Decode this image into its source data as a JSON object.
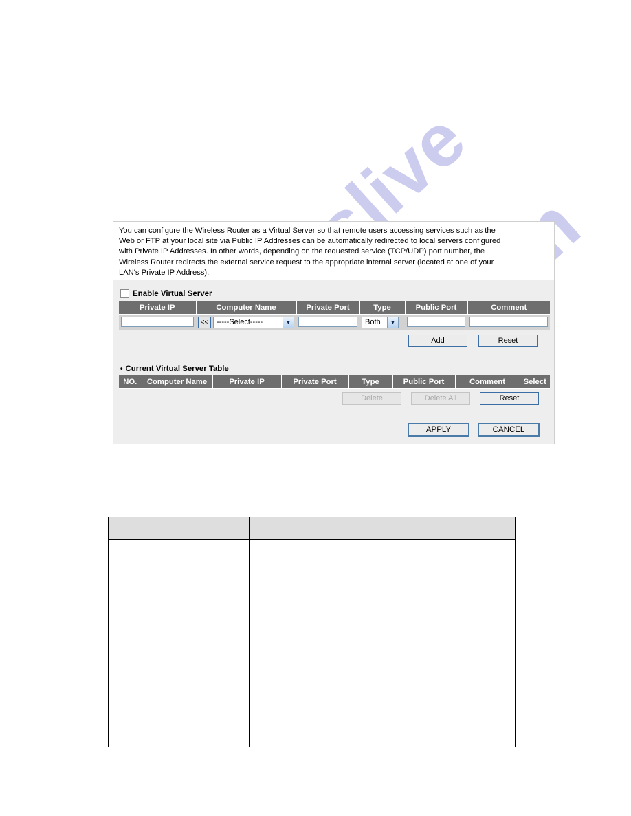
{
  "watermark": {
    "part1": "manualslive",
    "part2": ".com"
  },
  "panel": {
    "intro_lines": [
      "You can configure the Wireless Router as a Virtual Server so that remote users accessing services such as the",
      "Web or FTP at your local site via Public IP Addresses can be automatically redirected to local servers configured",
      "with Private IP Addresses. In other words, depending on the requested service (TCP/UDP) port number, the",
      "Wireless Router redirects the external service request to the appropriate internal server (located at one of your",
      "LAN's Private IP Address)."
    ],
    "enable_checkbox_label": "Enable Virtual Server",
    "entry_table": {
      "headers": [
        "Private IP",
        "Computer Name",
        "Private Port",
        "Type",
        "Public Port",
        "Comment"
      ],
      "private_ip_value": "",
      "private_ip_placeholder": "",
      "pick_button_label": "<<",
      "computer_name_selected": "-----Select-----",
      "private_port_value": "",
      "type_selected": "Both",
      "public_port_value": "",
      "comment_value": ""
    },
    "entry_buttons": {
      "add_label": "Add",
      "reset_label": "Reset"
    },
    "current_table": {
      "title": "Current Virtual Server Table",
      "bullet": "•",
      "headers": [
        "NO.",
        "Computer Name",
        "Private IP",
        "Private Port",
        "Type",
        "Public Port",
        "Comment",
        "Select"
      ],
      "rows": []
    },
    "current_buttons": {
      "delete_label": "Delete",
      "delete_all_label": "Delete All",
      "reset_label": "Reset",
      "delete_disabled": true,
      "delete_all_disabled": true
    },
    "footer_buttons": {
      "apply_label": "APPLY",
      "cancel_label": "CANCEL"
    }
  },
  "doc_table": {
    "header_cells": [
      "",
      ""
    ],
    "rows": [
      [
        "",
        ""
      ],
      [
        "",
        ""
      ],
      [
        "",
        ""
      ]
    ]
  },
  "colors": {
    "panel_bg": "#eeeeee",
    "table_header_bg": "#6e6e6e",
    "table_row_bg": "#d2d2d2",
    "doc_header_bg": "#dedede",
    "watermark": "#b9b9e8",
    "button_border": "#3a6ea5"
  }
}
